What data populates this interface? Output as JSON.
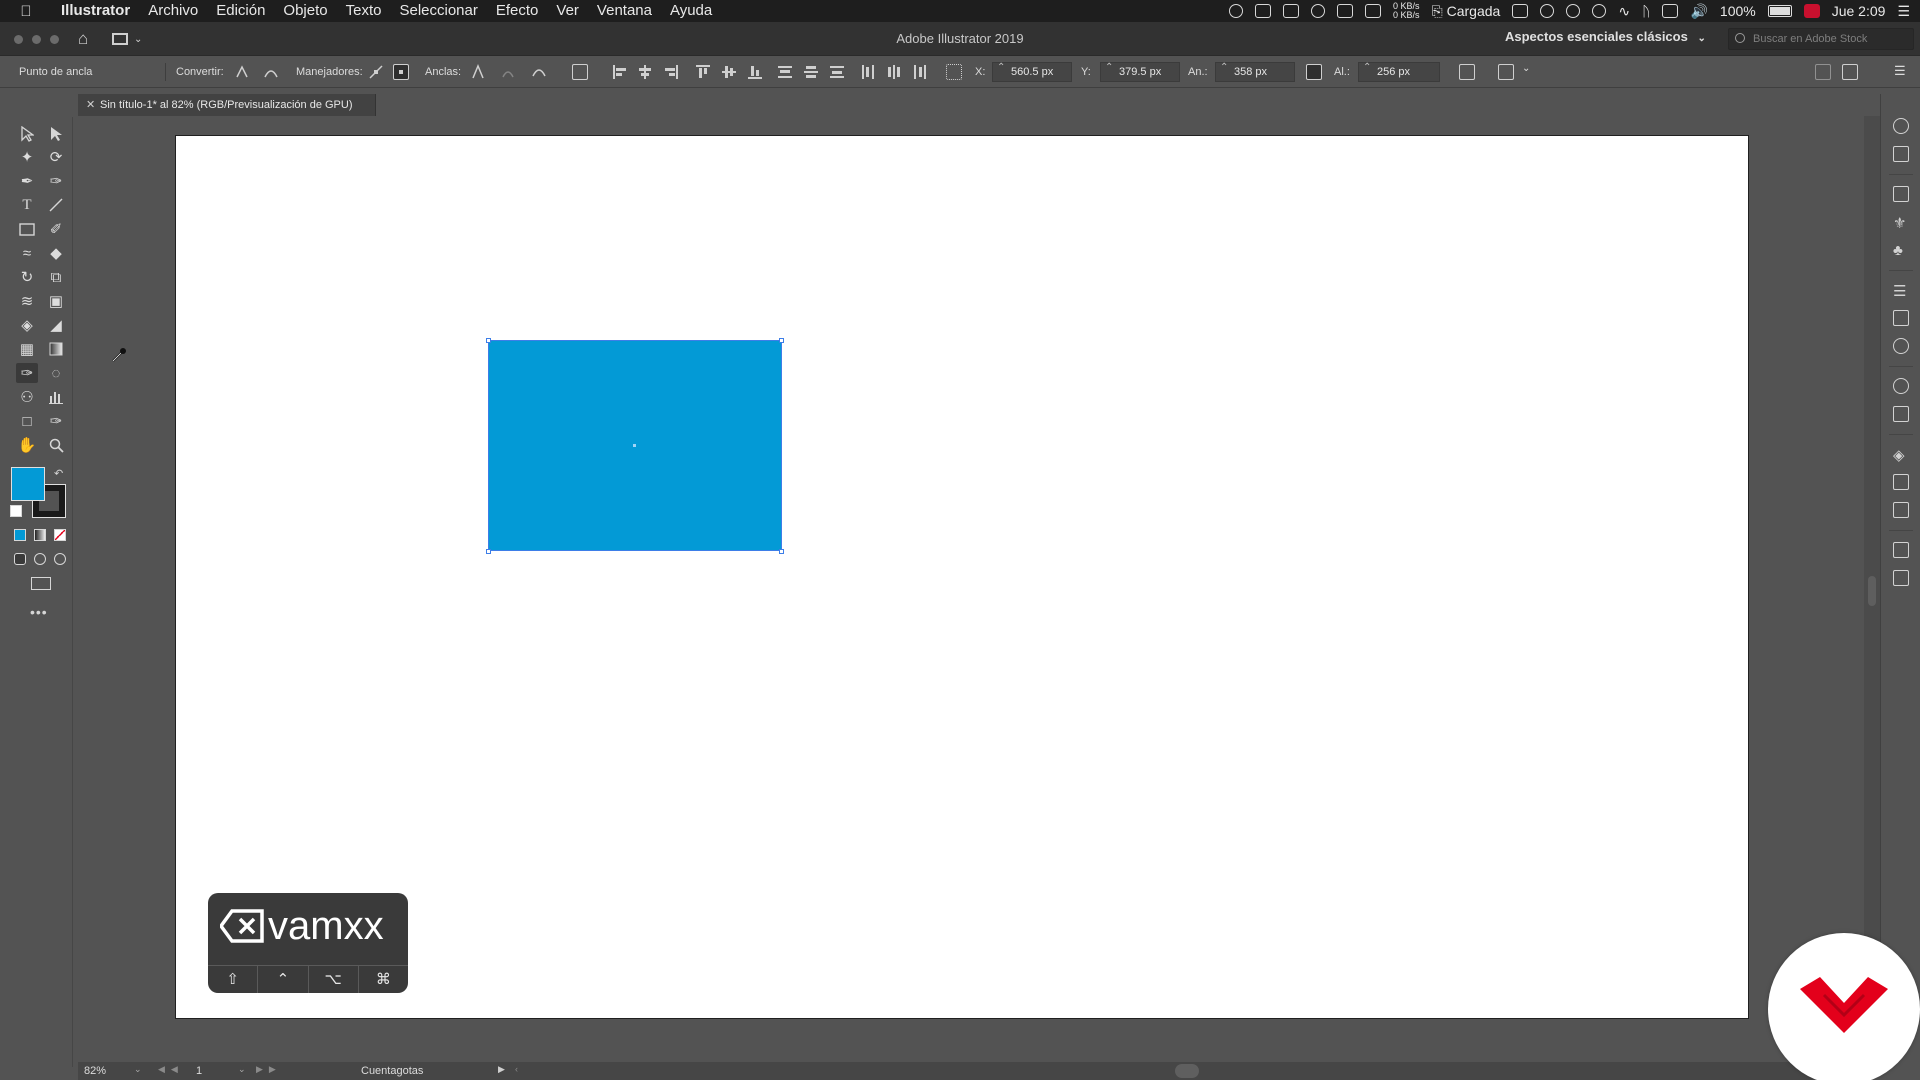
{
  "menubar": {
    "app": "Illustrator",
    "items": [
      "Archivo",
      "Edición",
      "Objeto",
      "Texto",
      "Seleccionar",
      "Efecto",
      "Ver",
      "Ventana",
      "Ayuda"
    ],
    "net_up": "0 KB/s",
    "net_down": "0 KB/s",
    "power_status": "Cargada",
    "battery": "100%",
    "clock": "Jue 2:09"
  },
  "titlebar": {
    "title": "Adobe Illustrator 2019",
    "workspace": "Aspectos esenciales clásicos",
    "search_placeholder": "Buscar en Adobe Stock"
  },
  "controlbar": {
    "selection_label": "Punto de ancla",
    "convert_label": "Convertir:",
    "handles_label": "Manejadores:",
    "anchors_label": "Anclas:",
    "x_label": "X:",
    "x_value": "560.5 px",
    "y_label": "Y:",
    "y_value": "379.5 px",
    "w_label": "An.:",
    "w_value": "358 px",
    "h_label": "Al.:",
    "h_value": "256 px"
  },
  "document": {
    "tab_title": "Sin título-1* al 82% (RGB/Previsualización de GPU)"
  },
  "colors": {
    "fill": "#039ad6",
    "stroke": "#1a1a1a",
    "selection": "#3d7ee8",
    "badge_red": "#e3001b"
  },
  "tools": [
    "selection-icon",
    "direct-selection-icon",
    "magic-wand-icon",
    "lasso-icon",
    "pen-icon",
    "curvature-icon",
    "type-icon",
    "line-segment-icon",
    "rectangle-icon",
    "paintbrush-icon",
    "shaper-icon",
    "eraser-icon",
    "rotate-icon",
    "scale-icon",
    "width-icon",
    "free-transform-icon",
    "shape-builder-icon",
    "perspective-icon",
    "mesh-icon",
    "gradient-icon",
    "eyedropper-icon",
    "blend-icon",
    "symbol-sprayer-icon",
    "column-graph-icon",
    "artboard-icon",
    "slice-icon",
    "hand-icon",
    "zoom-icon"
  ],
  "statusbar": {
    "zoom": "82%",
    "page": "1",
    "current_tool": "Cuentagotas"
  },
  "keystroke_widget": {
    "brand": "vamxx",
    "keys": [
      "⇧",
      "⌃",
      "⌥",
      "⌘"
    ]
  }
}
